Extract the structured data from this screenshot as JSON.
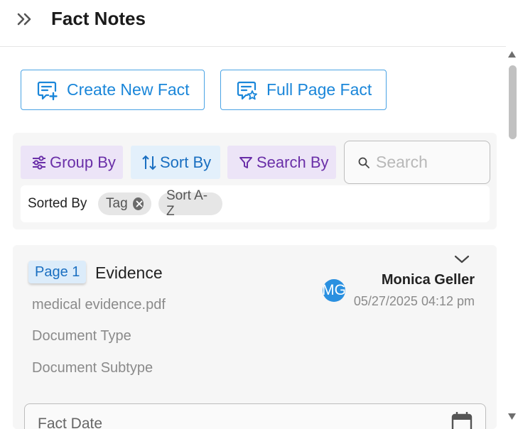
{
  "header": {
    "title": "Fact Notes",
    "expand_icon": "double-chevron-right-icon"
  },
  "actions": {
    "create_label": "Create New Fact",
    "full_page_label": "Full Page Fact"
  },
  "filters": {
    "group_by": "Group By",
    "sort_by": "Sort By",
    "search_by": "Search By",
    "search_placeholder": "Search",
    "sorted_by_label": "Sorted By",
    "chips": [
      "Tag",
      "Sort A-Z"
    ]
  },
  "fact": {
    "page_badge": "Page 1",
    "title": "Evidence",
    "file": "medical evidence.pdf",
    "document_type": "Document Type",
    "document_subtype": "Document Subtype",
    "author_initials": "MG",
    "author": "Monica Geller",
    "timestamp": "05/27/2025 04:12 pm",
    "fact_date_placeholder": "Fact Date"
  },
  "colors": {
    "primary_blue": "#1a86d9",
    "purple": "#6a2fa8",
    "avatar_blue": "#2a90e0"
  }
}
